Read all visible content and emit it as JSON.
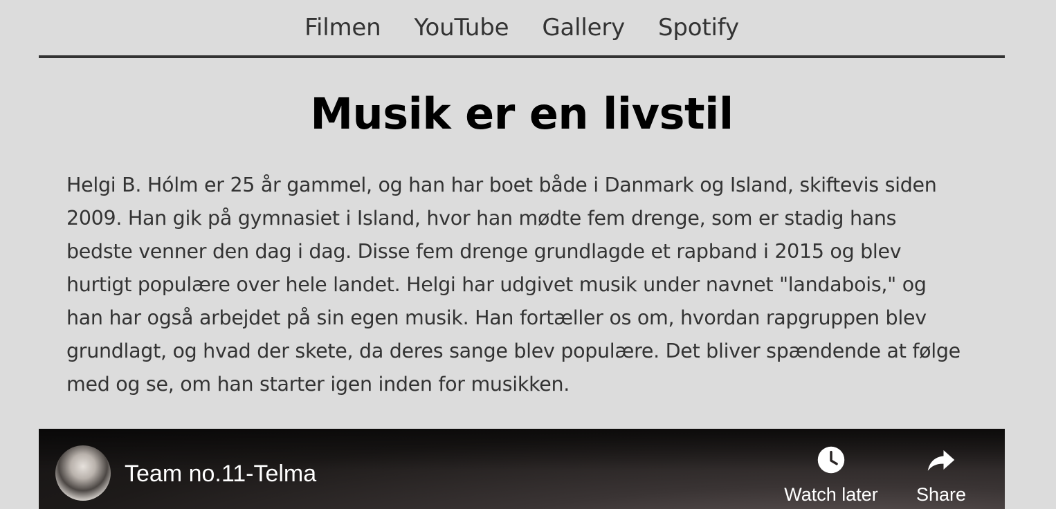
{
  "nav": {
    "items": [
      "Filmen",
      "YouTube",
      "Gallery",
      "Spotify"
    ]
  },
  "main": {
    "title": "Musik er en livstil",
    "intro": "Helgi B. Hólm er 25 år gammel, og han har boet både i Danmark og Island, skiftevis siden 2009. Han gik på gymnasiet i Island, hvor han mødte fem drenge, som er stadig hans bedste venner den dag i dag. Disse fem drenge grundlagde et rapband i 2015 og blev hurtigt populære over hele landet. Helgi har udgivet musik under navnet \"landabois,\" og han har også arbejdet på sin egen musik. Han fortæller os om, hvordan rapgruppen blev grundlagt, og hvad der skete, da deres sange blev populære. Det bliver spændende at følge med og se, om han starter igen inden for musikken."
  },
  "video": {
    "title": "Team no.11-Telma",
    "watch_later": "Watch later",
    "share": "Share",
    "icons": {
      "watch_later": "clock-icon",
      "share": "share-arrow-icon"
    }
  },
  "colors": {
    "background": "#dcdcdc",
    "text": "#333333",
    "title": "#000000",
    "nav_rule": "#333333"
  }
}
